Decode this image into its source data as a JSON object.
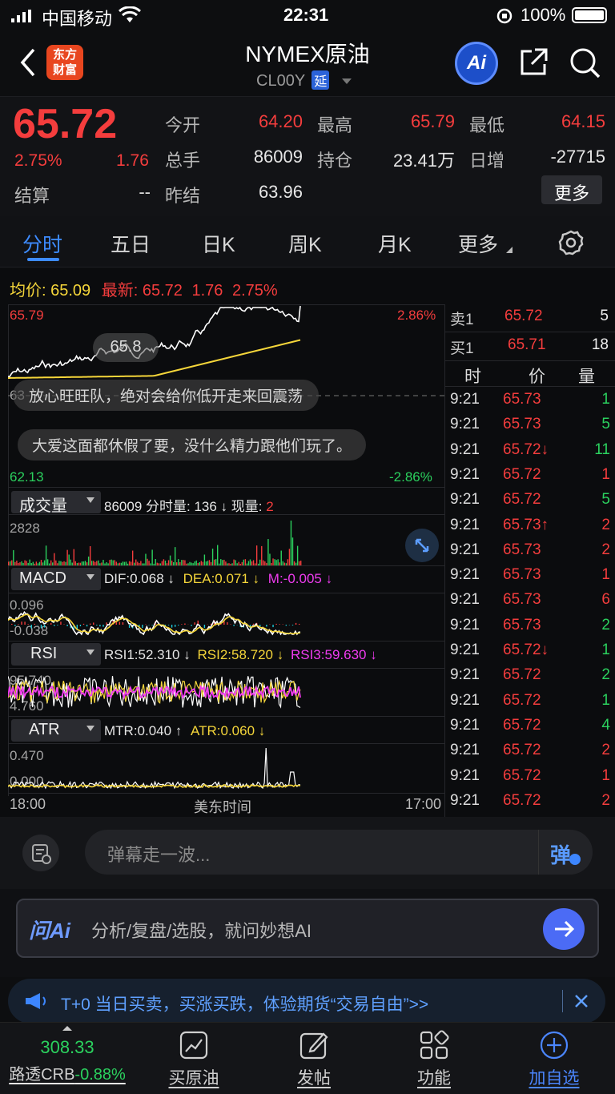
{
  "status_bar": {
    "carrier": "中国移动",
    "time": "22:31",
    "battery": "100%"
  },
  "header": {
    "title": "NYMEX原油",
    "code": "CL00Y",
    "delay_badge": "延",
    "logo_text_1": "东方",
    "logo_text_2": "财富",
    "ai_label": "Ai"
  },
  "quote": {
    "price": "65.72",
    "change_pct": "2.75%",
    "change": "1.76",
    "settle_label": "结算",
    "settle_value": "--",
    "open_label": "今开",
    "open_value": "64.20",
    "high_label": "最高",
    "high_value": "65.79",
    "low_label": "最低",
    "low_value": "64.15",
    "volume_label": "总手",
    "volume_value": "86009",
    "oi_label": "持仓",
    "oi_value": "23.41万",
    "daily_inc_label": "日增",
    "daily_inc_value": "-27715",
    "prev_settle_label": "昨结",
    "prev_settle_value": "63.96",
    "more_button": "更多"
  },
  "tabs": [
    "分时",
    "五日",
    "日K",
    "周K",
    "月K",
    "更多"
  ],
  "active_tab": "分时",
  "avg_line": {
    "avg_label": "均价:",
    "avg_value": "65.09",
    "latest_label": "最新:",
    "latest_value": "65.72",
    "latest_change": "1.76",
    "latest_pct": "2.75%"
  },
  "price_chart": {
    "y_top": "65.79",
    "y_bottom": "62.13",
    "pct_top": "2.86%",
    "pct_bottom": "-2.86%",
    "bubble_price": "65.8",
    "prev_label": "63",
    "danmu_1": "放心旺旺队，绝对会给你低开走来回震荡",
    "danmu_2": "大爱这面都休假了要，没什么精力跟他们玩了。"
  },
  "volume_panel": {
    "selector": "成交量",
    "text_1": "86009 分时量: 136 ↓ 现量:",
    "text_2": "2",
    "y_max": "2828"
  },
  "macd_panel": {
    "selector": "MACD",
    "dif": "DIF:0.068 ↓",
    "dea": "DEA:0.071 ↓",
    "m": "M:-0.005 ↓",
    "y_top": "0.096",
    "y_bottom": "-0.038"
  },
  "rsi_panel": {
    "selector": "RSI",
    "rsi1": "RSI1:52.310 ↓",
    "rsi2": "RSI2:58.720 ↓",
    "rsi3": "RSI3:59.630 ↓",
    "y_top": "95.740",
    "y_bottom": "4.760"
  },
  "atr_panel": {
    "selector": "ATR",
    "mtr": "MTR:0.040 ↑",
    "atr": "ATR:0.060 ↓",
    "y_top": "0.470",
    "y_bottom": "0.000"
  },
  "x_axis": {
    "start": "18:00",
    "mid": "美东时间",
    "end": "17:00"
  },
  "order_book": {
    "sell_label": "卖1",
    "sell_price": "65.72",
    "sell_qty": "5",
    "buy_label": "买1",
    "buy_price": "65.71",
    "buy_qty": "18",
    "col_time": "时",
    "col_price": "价",
    "col_qty": "量"
  },
  "ticks": [
    {
      "time": "9:21",
      "price": "65.73",
      "qty": "1",
      "dir": "",
      "qcolor": "green"
    },
    {
      "time": "9:21",
      "price": "65.73",
      "qty": "5",
      "dir": "",
      "qcolor": "green"
    },
    {
      "time": "9:21",
      "price": "65.72↓",
      "qty": "11",
      "dir": "down",
      "qcolor": "green"
    },
    {
      "time": "9:21",
      "price": "65.72",
      "qty": "1",
      "dir": "",
      "qcolor": "red"
    },
    {
      "time": "9:21",
      "price": "65.72",
      "qty": "5",
      "dir": "",
      "qcolor": "green"
    },
    {
      "time": "9:21",
      "price": "65.73↑",
      "qty": "2",
      "dir": "up",
      "qcolor": "red"
    },
    {
      "time": "9:21",
      "price": "65.73",
      "qty": "2",
      "dir": "",
      "qcolor": "red"
    },
    {
      "time": "9:21",
      "price": "65.73",
      "qty": "1",
      "dir": "",
      "qcolor": "red"
    },
    {
      "time": "9:21",
      "price": "65.73",
      "qty": "6",
      "dir": "",
      "qcolor": "red"
    },
    {
      "time": "9:21",
      "price": "65.73",
      "qty": "2",
      "dir": "",
      "qcolor": "green"
    },
    {
      "time": "9:21",
      "price": "65.72↓",
      "qty": "1",
      "dir": "down",
      "qcolor": "green"
    },
    {
      "time": "9:21",
      "price": "65.72",
      "qty": "2",
      "dir": "",
      "qcolor": "green"
    },
    {
      "time": "9:21",
      "price": "65.72",
      "qty": "1",
      "dir": "",
      "qcolor": "green"
    },
    {
      "time": "9:21",
      "price": "65.72",
      "qty": "4",
      "dir": "",
      "qcolor": "green"
    },
    {
      "time": "9:21",
      "price": "65.72",
      "qty": "2",
      "dir": "",
      "qcolor": "red"
    },
    {
      "time": "9:21",
      "price": "65.72",
      "qty": "1",
      "dir": "",
      "qcolor": "red"
    },
    {
      "time": "9:21",
      "price": "65.72",
      "qty": "2",
      "dir": "",
      "qcolor": "red"
    }
  ],
  "danmu_bar": {
    "placeholder": "弹幕走一波...",
    "button": "弹"
  },
  "ai_bar": {
    "logo": "问Ai",
    "placeholder": "分析/复盘/选股，就问妙想AI"
  },
  "promo": {
    "text": "T+0 当日买卖，买涨买跌，体验期货“交易自由”>>"
  },
  "bottom_nav": {
    "index_value": "308.33",
    "index_name": "路透CRB",
    "index_change": "-0.88%",
    "items": [
      "买原油",
      "发帖",
      "功能",
      "加自选"
    ]
  }
}
